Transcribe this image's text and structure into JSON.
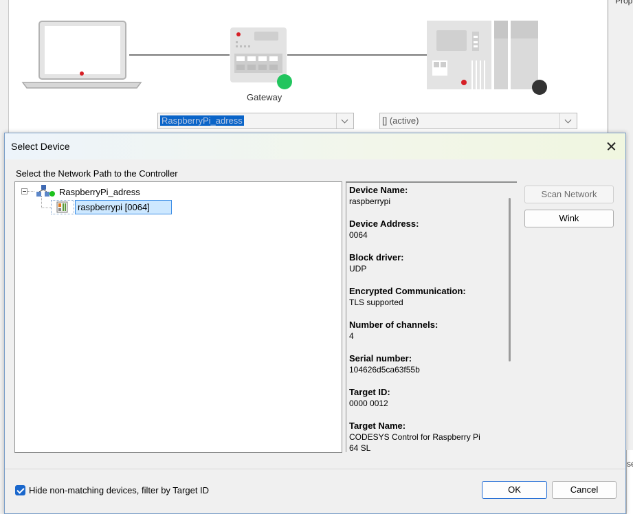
{
  "background": {
    "properties_title": "Prop",
    "gateway": {
      "label": "Gateway",
      "status_color": "#22c55e"
    },
    "controller": {
      "status_color": "#333333"
    },
    "gateway_combo_value": "RaspberryPi_adress",
    "device_combo_value": "[] (active)",
    "edge_fragment_text": "se"
  },
  "dialog": {
    "title": "Select Device",
    "path_label": "Select the Network Path to the Controller",
    "tree": {
      "gateway_node": {
        "label": "RaspberryPi_adress",
        "icon": "network-gateway-icon"
      },
      "device_node": {
        "label": "raspberrypi [0064]",
        "icon": "plc-device-icon"
      }
    },
    "info": [
      {
        "label": "Device Name:",
        "value": "raspberrypi"
      },
      {
        "label": "Device Address:",
        "value": "0064"
      },
      {
        "label": "Block driver:",
        "value": "UDP"
      },
      {
        "label": "Encrypted Communication:",
        "value": "TLS supported"
      },
      {
        "label": "Number of channels:",
        "value": "4"
      },
      {
        "label": "Serial number:",
        "value": "104626d5ca63f55b"
      },
      {
        "label": "Target ID:",
        "value": "0000 0012"
      },
      {
        "label": "Target Name:",
        "value": "CODESYS Control for Raspberry Pi",
        "value2": "64 SL"
      }
    ],
    "buttons": {
      "scan": "Scan Network",
      "wink": "Wink",
      "ok": "OK",
      "cancel": "Cancel"
    },
    "hide_checkbox": {
      "label": "Hide non-matching devices, filter by Target ID",
      "checked": true
    }
  },
  "colors": {
    "accent": "#1a67cc",
    "selection": "#cde8ff",
    "selection_border": "#3c8ee6"
  }
}
